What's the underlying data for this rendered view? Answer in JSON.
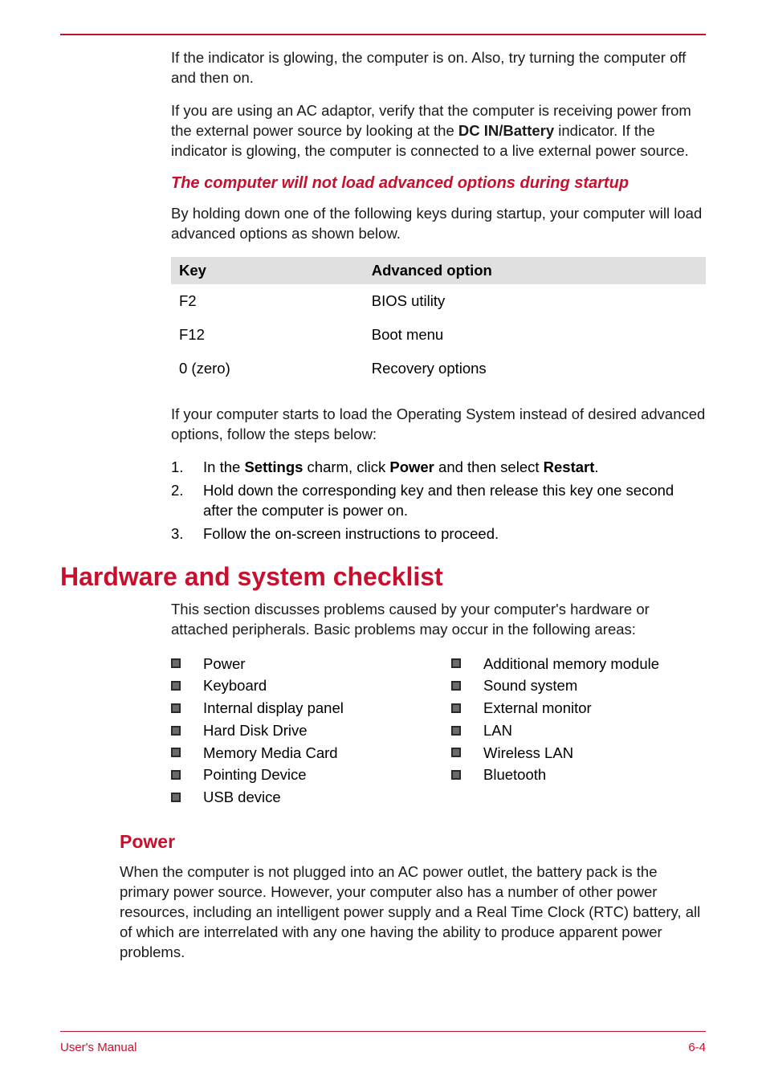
{
  "para1": "If the indicator is glowing, the computer is on. Also, try turning the computer off and then on.",
  "para2_a": "If you are using an AC adaptor, verify that the computer is receiving power from the external power source by looking at the ",
  "para2_bold": "DC IN/Battery",
  "para2_b": " indicator. If the indicator is glowing, the computer is connected to a live external power source.",
  "heading3": "The computer will not load advanced options during startup",
  "para3": "By holding down one of the following keys during startup, your computer will load advanced options as shown below.",
  "table": {
    "head_key": "Key",
    "head_opt": "Advanced option",
    "rows": [
      {
        "key": "F2",
        "opt": "BIOS utility"
      },
      {
        "key": "F12",
        "opt": "Boot menu"
      },
      {
        "key": "0 (zero)",
        "opt": "Recovery options"
      }
    ]
  },
  "para4": "If your computer starts to load the Operating System instead of desired advanced options, follow the steps below:",
  "ol": [
    {
      "n": "1.",
      "pre": "In the ",
      "b1": "Settings",
      "mid1": " charm, click ",
      "b2": "Power",
      "mid2": " and then select ",
      "b3": "Restart",
      "post": "."
    },
    {
      "n": "2.",
      "text": "Hold down the corresponding key and then release this key one second after the computer is power on."
    },
    {
      "n": "3.",
      "text": "Follow the on-screen instructions to proceed."
    }
  ],
  "h1": "Hardware and system checklist",
  "para5": "This section discusses problems caused by your computer's hardware or attached peripherals. Basic problems may occur in the following areas:",
  "bullets_left": [
    "Power",
    "Keyboard",
    "Internal display panel",
    "Hard Disk Drive",
    "Memory Media Card",
    "Pointing Device",
    "USB device"
  ],
  "bullets_right": [
    "Additional memory module",
    "Sound system",
    "External monitor",
    "LAN",
    "Wireless LAN",
    "Bluetooth"
  ],
  "h2": "Power",
  "para6": "When the computer is not plugged into an AC power outlet, the battery pack is the primary power source. However, your computer also has a number of other power resources, including an intelligent power supply and a Real Time Clock (RTC) battery, all of which are interrelated with any one having the ability to produce apparent power problems.",
  "footer_left": "User's Manual",
  "footer_right": "6-4"
}
